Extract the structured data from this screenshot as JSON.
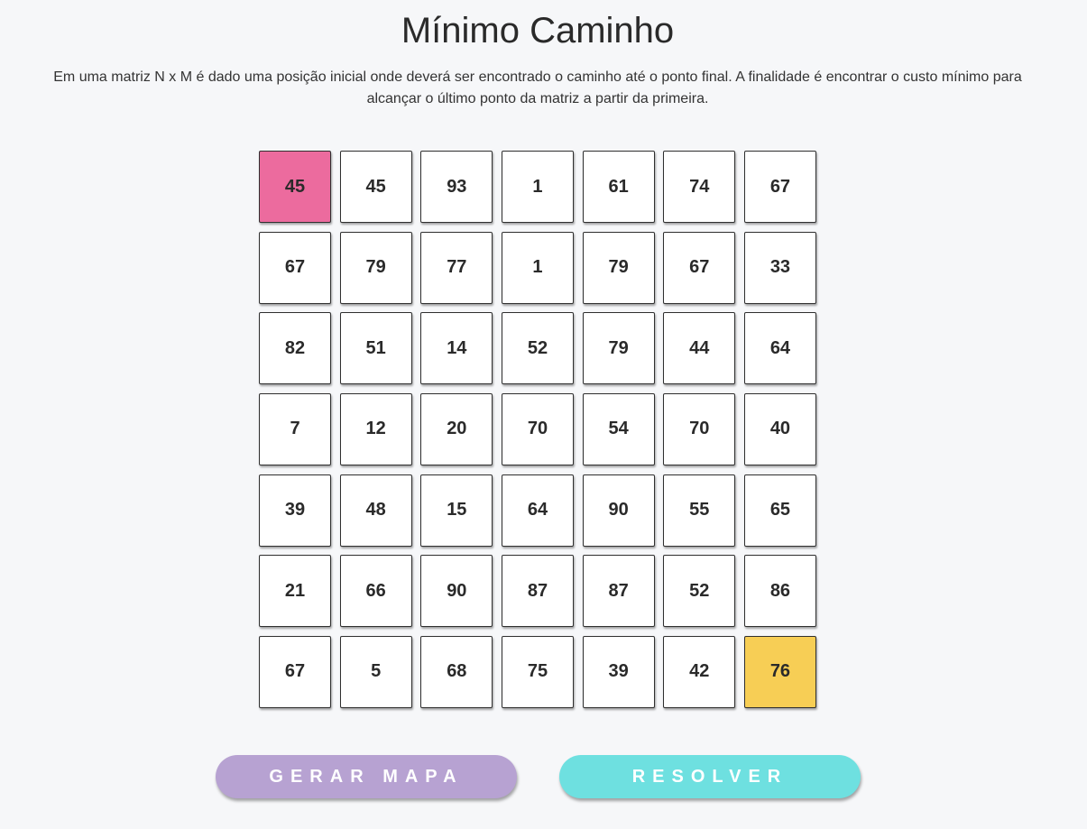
{
  "header": {
    "title": "Mínimo Caminho",
    "description": "Em uma matriz N x M é dado uma posição inicial onde deverá ser encontrado o caminho até o ponto final. A finalidade é encontrar o custo mínimo para alcançar o último ponto da matriz a partir da primeira."
  },
  "grid": {
    "rows": [
      [
        45,
        45,
        93,
        1,
        61,
        74,
        67
      ],
      [
        67,
        79,
        77,
        1,
        79,
        67,
        33
      ],
      [
        82,
        51,
        14,
        52,
        79,
        44,
        64
      ],
      [
        7,
        12,
        20,
        70,
        54,
        70,
        40
      ],
      [
        39,
        48,
        15,
        64,
        90,
        55,
        65
      ],
      [
        21,
        66,
        90,
        87,
        87,
        52,
        86
      ],
      [
        67,
        5,
        68,
        75,
        39,
        42,
        76
      ]
    ],
    "start_color": "#ec6b9e",
    "end_color": "#f7ce55"
  },
  "buttons": {
    "generate_label": "GERAR MAPA",
    "solve_label": "RESOLVER",
    "generate_color": "#b7a2d2",
    "solve_color": "#6ee0e0"
  }
}
